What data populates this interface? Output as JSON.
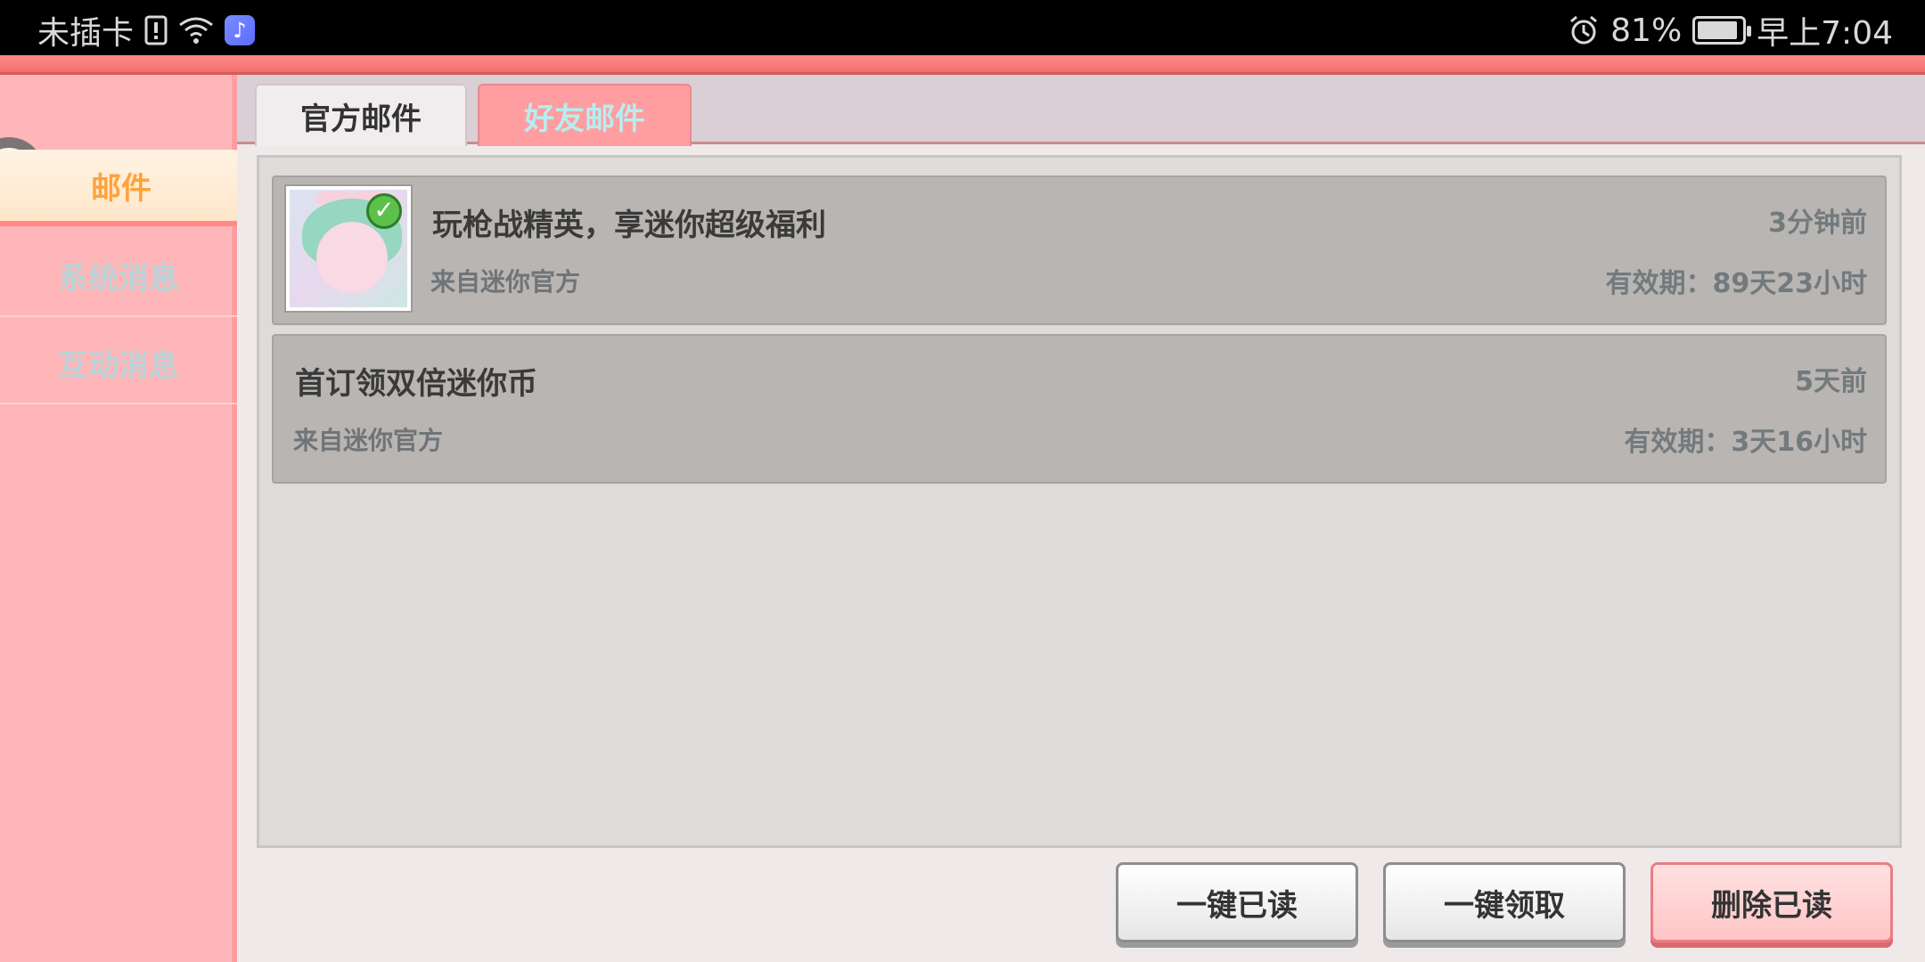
{
  "status_bar": {
    "carrier": "未插卡",
    "battery_percent": "81%",
    "time": "早上7:04",
    "battery_level": 0.81,
    "icons": [
      "sim-alert-icon",
      "wifi-icon",
      "music-app-icon",
      "alarm-icon",
      "battery-icon"
    ]
  },
  "sidebar": {
    "items": [
      {
        "label": "邮件",
        "active": true
      },
      {
        "label": "系统消息",
        "active": false
      },
      {
        "label": "互动消息",
        "active": false
      }
    ]
  },
  "tabs": [
    {
      "label": "官方邮件",
      "active": true
    },
    {
      "label": "好友邮件",
      "active": false
    }
  ],
  "mails": [
    {
      "title": "玩枪战精英，享迷你超级福利",
      "sender": "来自迷你官方",
      "time": "3分钟前",
      "expiry": "有效期：89天23小时",
      "has_avatar": true,
      "checked": true
    },
    {
      "title": "首订领双倍迷你币",
      "sender": "来自迷你官方",
      "time": "5天前",
      "expiry": "有效期：3天16小时",
      "has_avatar": false,
      "checked": false
    }
  ],
  "actions": {
    "read_all": "一键已读",
    "claim_all": "一键领取",
    "delete_read": "删除已读"
  },
  "colors": {
    "sidebar_bg": "#ffb6b8",
    "active_nav_text": "#ffa23a",
    "inactive_tab_bg": "#ff9da0",
    "mail_row_bg": "#b8b5b2"
  }
}
